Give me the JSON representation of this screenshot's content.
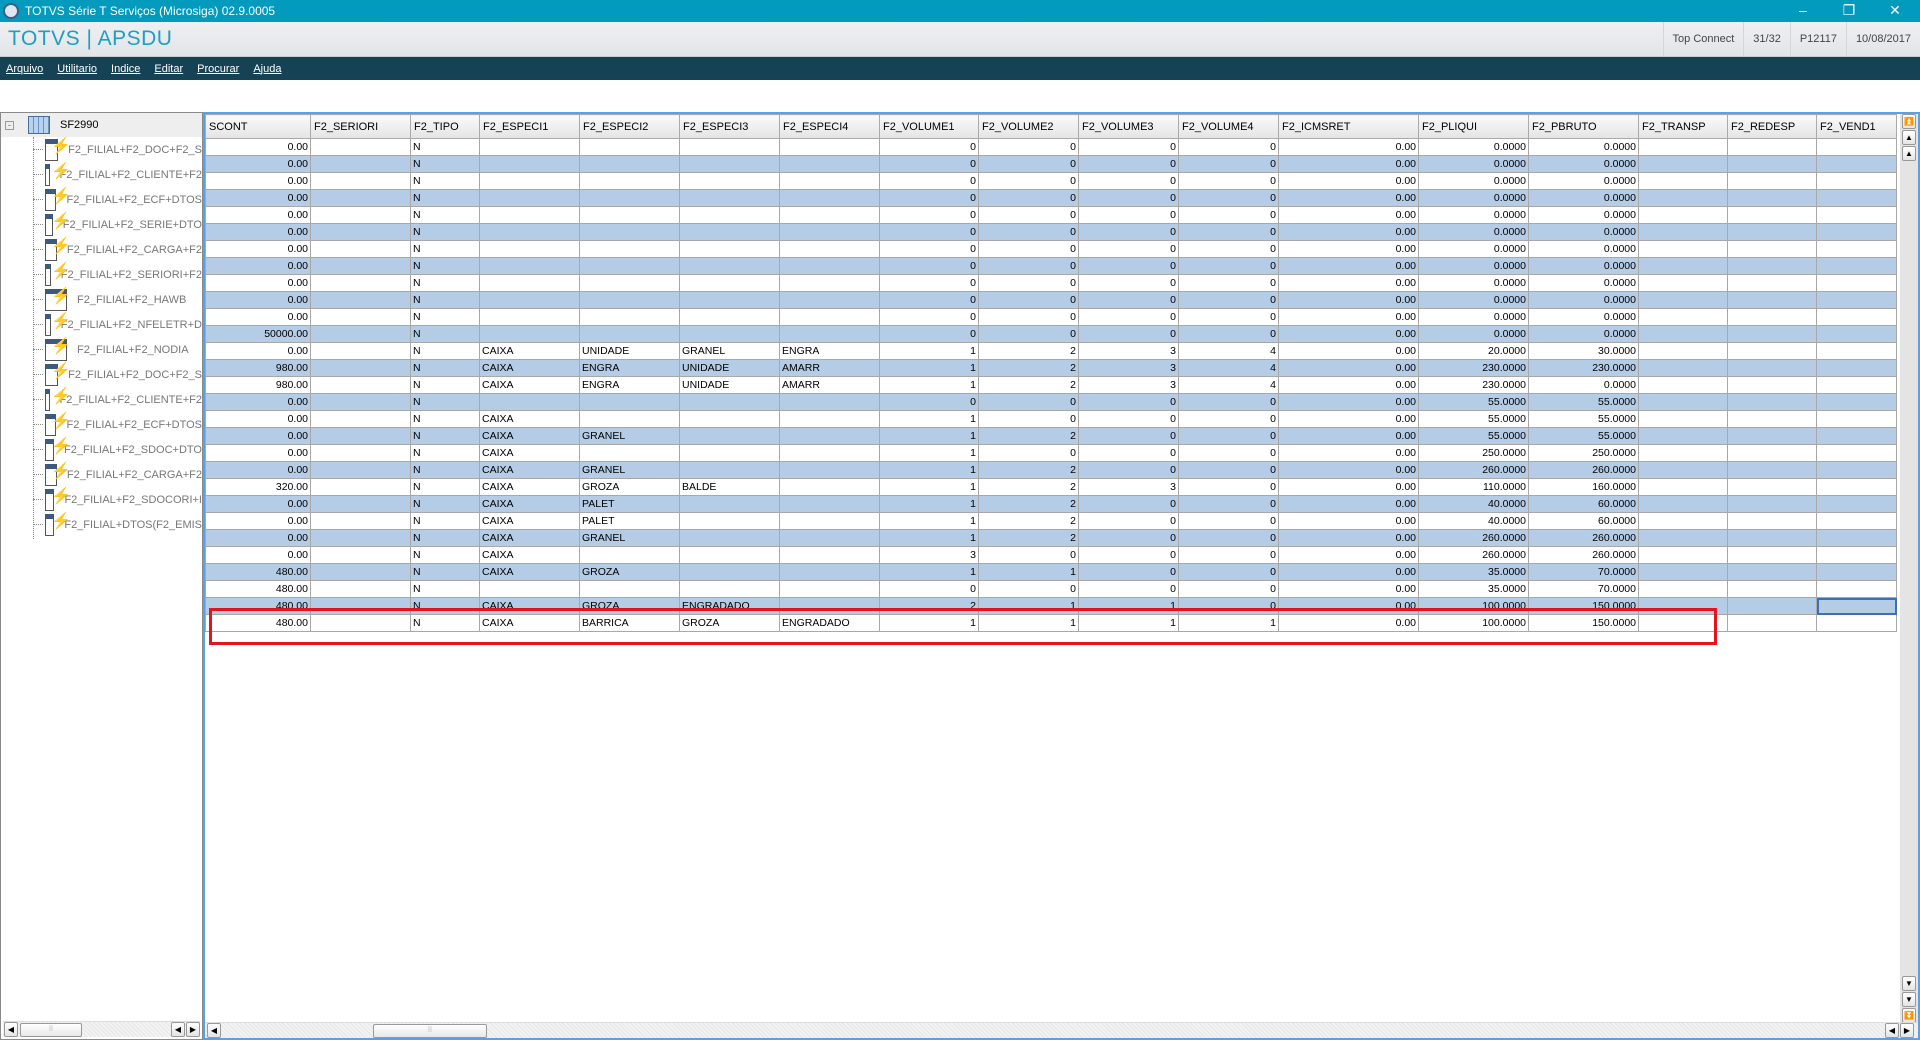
{
  "window": {
    "title": "TOTVS Série T Serviços (Microsiga) 02.9.0005",
    "minimize": "–",
    "restore": "❐",
    "close": "✕"
  },
  "header": {
    "brand": "TOTVS | APSDU",
    "connection": "Top Connect",
    "counter": "31/32",
    "release": "P12117",
    "date": "10/08/2017"
  },
  "menu": [
    "Arquivo",
    "Utilitario",
    "Indice",
    "Editar",
    "Procurar",
    "Ajuda"
  ],
  "tree": {
    "root": "SF2990",
    "indexes": [
      "F2_FILIAL+F2_DOC+F2_S",
      "F2_FILIAL+F2_CLIENTE+F2",
      "F2_FILIAL+F2_ECF+DTOS",
      "F2_FILIAL+F2_SERIE+DTO",
      "F2_FILIAL+F2_CARGA+F2",
      "F2_FILIAL+F2_SERIORI+F2",
      "F2_FILIAL+F2_HAWB",
      "F2_FILIAL+F2_NFELETR+D",
      "F2_FILIAL+F2_NODIA",
      "F2_FILIAL+F2_DOC+F2_S",
      "F2_FILIAL+F2_CLIENTE+F2",
      "F2_FILIAL+F2_ECF+DTOS",
      "F2_FILIAL+F2_SDOC+DTO",
      "F2_FILIAL+F2_CARGA+F2",
      "F2_FILIAL+F2_SDOCORI+I",
      "F2_FILIAL+DTOS(F2_EMIS"
    ]
  },
  "grid": {
    "columns": [
      "SCONT",
      "F2_SERIORI",
      "F2_TIPO",
      "F2_ESPECI1",
      "F2_ESPECI2",
      "F2_ESPECI3",
      "F2_ESPECI4",
      "F2_VOLUME1",
      "F2_VOLUME2",
      "F2_VOLUME3",
      "F2_VOLUME4",
      "F2_ICMSRET",
      "F2_PLIQUI",
      "F2_PBRUTO",
      "F2_TRANSP",
      "F2_REDESP",
      "F2_VEND1"
    ],
    "rows": [
      [
        "0.00",
        "",
        "N",
        "",
        "",
        "",
        "",
        "0",
        "0",
        "0",
        "0",
        "0.00",
        "0.0000",
        "0.0000",
        "",
        "",
        ""
      ],
      [
        "0.00",
        "",
        "N",
        "",
        "",
        "",
        "",
        "0",
        "0",
        "0",
        "0",
        "0.00",
        "0.0000",
        "0.0000",
        "",
        "",
        ""
      ],
      [
        "0.00",
        "",
        "N",
        "",
        "",
        "",
        "",
        "0",
        "0",
        "0",
        "0",
        "0.00",
        "0.0000",
        "0.0000",
        "",
        "",
        ""
      ],
      [
        "0.00",
        "",
        "N",
        "",
        "",
        "",
        "",
        "0",
        "0",
        "0",
        "0",
        "0.00",
        "0.0000",
        "0.0000",
        "",
        "",
        ""
      ],
      [
        "0.00",
        "",
        "N",
        "",
        "",
        "",
        "",
        "0",
        "0",
        "0",
        "0",
        "0.00",
        "0.0000",
        "0.0000",
        "",
        "",
        ""
      ],
      [
        "0.00",
        "",
        "N",
        "",
        "",
        "",
        "",
        "0",
        "0",
        "0",
        "0",
        "0.00",
        "0.0000",
        "0.0000",
        "",
        "",
        ""
      ],
      [
        "0.00",
        "",
        "N",
        "",
        "",
        "",
        "",
        "0",
        "0",
        "0",
        "0",
        "0.00",
        "0.0000",
        "0.0000",
        "",
        "",
        ""
      ],
      [
        "0.00",
        "",
        "N",
        "",
        "",
        "",
        "",
        "0",
        "0",
        "0",
        "0",
        "0.00",
        "0.0000",
        "0.0000",
        "",
        "",
        ""
      ],
      [
        "0.00",
        "",
        "N",
        "",
        "",
        "",
        "",
        "0",
        "0",
        "0",
        "0",
        "0.00",
        "0.0000",
        "0.0000",
        "",
        "",
        ""
      ],
      [
        "0.00",
        "",
        "N",
        "",
        "",
        "",
        "",
        "0",
        "0",
        "0",
        "0",
        "0.00",
        "0.0000",
        "0.0000",
        "",
        "",
        ""
      ],
      [
        "0.00",
        "",
        "N",
        "",
        "",
        "",
        "",
        "0",
        "0",
        "0",
        "0",
        "0.00",
        "0.0000",
        "0.0000",
        "",
        "",
        ""
      ],
      [
        "50000.00",
        "",
        "N",
        "",
        "",
        "",
        "",
        "0",
        "0",
        "0",
        "0",
        "0.00",
        "0.0000",
        "0.0000",
        "",
        "",
        ""
      ],
      [
        "0.00",
        "",
        "N",
        "CAIXA",
        "UNIDADE",
        "GRANEL",
        "ENGRA",
        "1",
        "2",
        "3",
        "4",
        "0.00",
        "20.0000",
        "30.0000",
        "",
        "",
        ""
      ],
      [
        "980.00",
        "",
        "N",
        "CAIXA",
        "ENGRA",
        "UNIDADE",
        "AMARR",
        "1",
        "2",
        "3",
        "4",
        "0.00",
        "230.0000",
        "230.0000",
        "",
        "",
        ""
      ],
      [
        "980.00",
        "",
        "N",
        "CAIXA",
        "ENGRA",
        "UNIDADE",
        "AMARR",
        "1",
        "2",
        "3",
        "4",
        "0.00",
        "230.0000",
        "0.0000",
        "",
        "",
        ""
      ],
      [
        "0.00",
        "",
        "N",
        "",
        "",
        "",
        "",
        "0",
        "0",
        "0",
        "0",
        "0.00",
        "55.0000",
        "55.0000",
        "",
        "",
        ""
      ],
      [
        "0.00",
        "",
        "N",
        "CAIXA",
        "",
        "",
        "",
        "1",
        "0",
        "0",
        "0",
        "0.00",
        "55.0000",
        "55.0000",
        "",
        "",
        ""
      ],
      [
        "0.00",
        "",
        "N",
        "CAIXA",
        "GRANEL",
        "",
        "",
        "1",
        "2",
        "0",
        "0",
        "0.00",
        "55.0000",
        "55.0000",
        "",
        "",
        ""
      ],
      [
        "0.00",
        "",
        "N",
        "CAIXA",
        "",
        "",
        "",
        "1",
        "0",
        "0",
        "0",
        "0.00",
        "250.0000",
        "250.0000",
        "",
        "",
        ""
      ],
      [
        "0.00",
        "",
        "N",
        "CAIXA",
        "GRANEL",
        "",
        "",
        "1",
        "2",
        "0",
        "0",
        "0.00",
        "260.0000",
        "260.0000",
        "",
        "",
        ""
      ],
      [
        "320.00",
        "",
        "N",
        "CAIXA",
        "GROZA",
        "BALDE",
        "",
        "1",
        "2",
        "3",
        "0",
        "0.00",
        "110.0000",
        "160.0000",
        "",
        "",
        ""
      ],
      [
        "0.00",
        "",
        "N",
        "CAIXA",
        "PALET",
        "",
        "",
        "1",
        "2",
        "0",
        "0",
        "0.00",
        "40.0000",
        "60.0000",
        "",
        "",
        ""
      ],
      [
        "0.00",
        "",
        "N",
        "CAIXA",
        "PALET",
        "",
        "",
        "1",
        "2",
        "0",
        "0",
        "0.00",
        "40.0000",
        "60.0000",
        "",
        "",
        ""
      ],
      [
        "0.00",
        "",
        "N",
        "CAIXA",
        "GRANEL",
        "",
        "",
        "1",
        "2",
        "0",
        "0",
        "0.00",
        "260.0000",
        "260.0000",
        "",
        "",
        ""
      ],
      [
        "0.00",
        "",
        "N",
        "CAIXA",
        "",
        "",
        "",
        "3",
        "0",
        "0",
        "0",
        "0.00",
        "260.0000",
        "260.0000",
        "",
        "",
        ""
      ],
      [
        "480.00",
        "",
        "N",
        "CAIXA",
        "GROZA",
        "",
        "",
        "1",
        "1",
        "0",
        "0",
        "0.00",
        "35.0000",
        "70.0000",
        "",
        "",
        ""
      ],
      [
        "480.00",
        "",
        "N",
        "",
        "",
        "",
        "",
        "0",
        "0",
        "0",
        "0",
        "0.00",
        "35.0000",
        "70.0000",
        "",
        "",
        ""
      ],
      [
        "480.00",
        "",
        "N",
        "CAIXA",
        "GROZA",
        "ENGRADADO",
        "",
        "2",
        "1",
        "1",
        "0",
        "0.00",
        "100.0000",
        "150.0000",
        "",
        "",
        ""
      ],
      [
        "480.00",
        "",
        "N",
        "CAIXA",
        "BARRICA",
        "GROZA",
        "ENGRADADO",
        "1",
        "1",
        "1",
        "1",
        "0.00",
        "100.0000",
        "150.0000",
        "",
        "",
        ""
      ]
    ]
  }
}
